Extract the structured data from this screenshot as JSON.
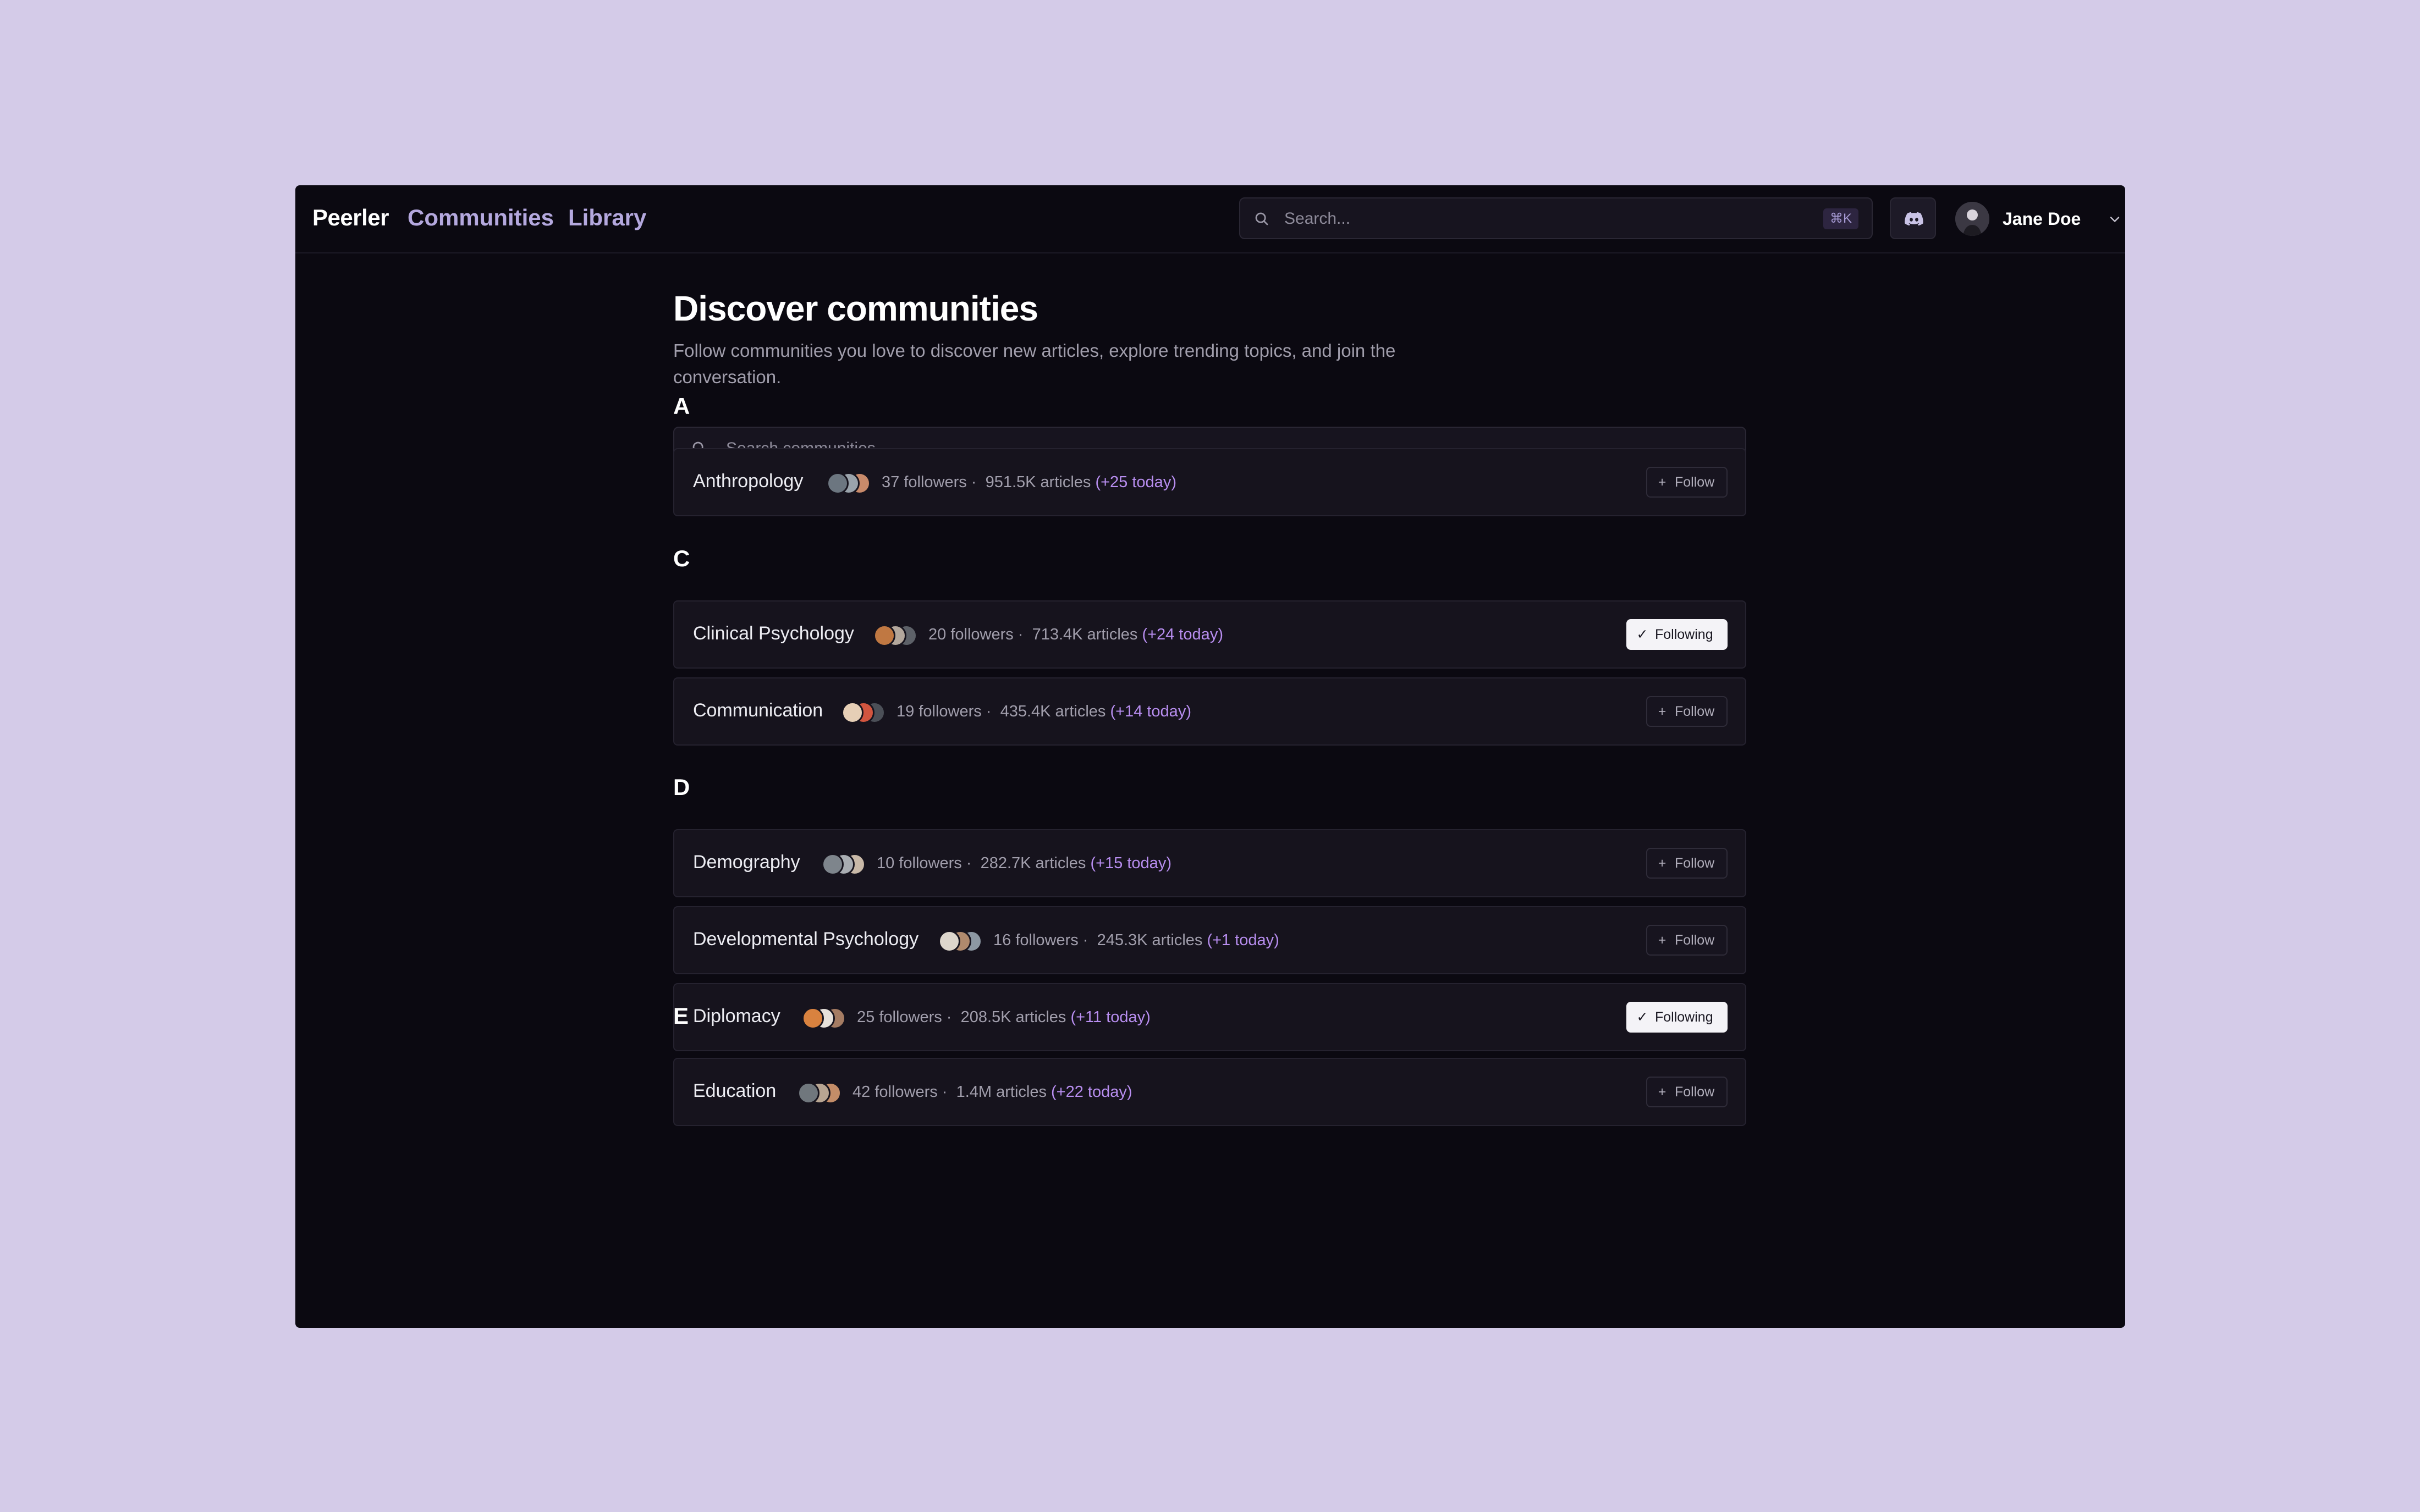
{
  "app": {
    "brand": "Peerler",
    "nav": [
      {
        "label": "Communities"
      },
      {
        "label": "Library"
      }
    ],
    "search": {
      "placeholder": "Search...",
      "shortcut": "⌘K"
    },
    "user": {
      "name": "Jane Doe"
    }
  },
  "colors": {
    "background": "#d4cbe8",
    "window": "#0b0911",
    "card": "#16131d",
    "accent": "#b88ef0",
    "nav_link": "#b4a8de"
  },
  "page": {
    "title": "Discover communities",
    "subtitle": "Follow communities you love to discover new articles, explore trending topics, and join the conversation.",
    "search_placeholder": "Search communities..."
  },
  "sections": [
    {
      "letter": "A",
      "communities": [
        {
          "name": "Anthropology",
          "followers": "37 followers ·",
          "articles": "951.5K articles",
          "today": "(+25 today)",
          "action": "Follow"
        }
      ]
    },
    {
      "letter": "C",
      "communities": [
        {
          "name": "Clinical Psychology",
          "followers": "20 followers ·",
          "articles": "713.4K articles",
          "today": "(+24 today)",
          "action": "Following"
        },
        {
          "name": "Communication",
          "followers": "19 followers ·",
          "articles": "435.4K articles",
          "today": "(+14 today)",
          "action": "Follow"
        }
      ]
    },
    {
      "letter": "D",
      "communities": [
        {
          "name": "Demography",
          "followers": "10 followers ·",
          "articles": "282.7K articles",
          "today": "(+15 today)",
          "action": "Follow"
        },
        {
          "name": "Developmental Psychology",
          "followers": "16 followers ·",
          "articles": "245.3K articles",
          "today": "(+1 today)",
          "action": "Follow"
        },
        {
          "name": "Diplomacy",
          "followers": "25 followers ·",
          "articles": "208.5K articles",
          "today": "(+11 today)",
          "action": "Following"
        }
      ]
    },
    {
      "letter": "E",
      "communities": [
        {
          "name": "Education",
          "followers": "42 followers ·",
          "articles": "1.4M articles",
          "today": "(+22 today)",
          "action": "Follow"
        }
      ]
    }
  ]
}
